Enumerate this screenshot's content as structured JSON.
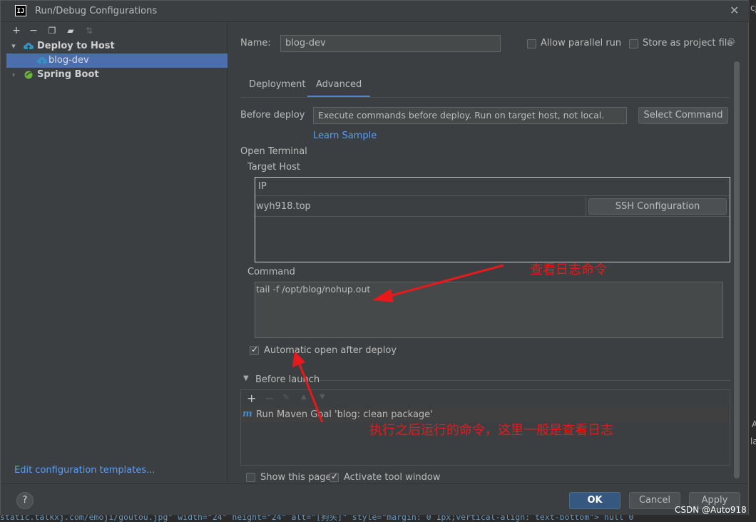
{
  "window": {
    "title": "Run/Debug Configurations",
    "icon": "intellij-icon"
  },
  "left": {
    "toolbar": [
      "add-icon",
      "remove-icon",
      "copy-icon",
      "folder-add-icon",
      "sort-icon"
    ],
    "tree": {
      "group1": "Deploy to Host",
      "group1_child": "blog-dev",
      "group2": "Spring Boot"
    },
    "edit_templates": "Edit configuration templates..."
  },
  "form": {
    "name_label": "Name:",
    "name_value": "blog-dev",
    "allow_parallel": "Allow parallel run",
    "store_project": "Store as project file",
    "tabs": [
      "Deployment",
      "Advanced"
    ],
    "active_tab": "Advanced",
    "before_deploy_label": "Before deploy",
    "before_deploy_value": "Execute commands before deploy. Run on target host, not local.",
    "select_command": "Select Command",
    "learn_sample": "Learn Sample",
    "open_terminal": "Open Terminal",
    "target_host": "Target Host",
    "table_header_ip": "IP",
    "host_value": "wyh918.top",
    "ssh_config": "SSH Configuration",
    "command_label": "Command",
    "command_value": "tail -f /opt/blog/nohup.out",
    "auto_open": "Automatic open after deploy",
    "before_launch": "Before launch",
    "launch_item": "Run Maven Goal 'blog: clean package'",
    "show_page": "Show this page",
    "activate_window": "Activate tool window"
  },
  "buttons": {
    "help": "?",
    "ok": "OK",
    "cancel": "Cancel",
    "apply": "Apply"
  },
  "annotations": {
    "a1": "查看日志命令",
    "a2": "执行之后运行的命令，这里一般是查看日志",
    "color": "#e8191c"
  },
  "background": {
    "code": "static.talkxj.com/emoji/goutou.jpg\" width=\"24\" height=\"24\" alt=\"[狗头]\" style=\"margin: 0 1px;vertical-align: text-bottom\"> null 0",
    "watermark": "CSDN @Auto918",
    "right_edge": [
      "cj",
      "A",
      "la"
    ]
  }
}
